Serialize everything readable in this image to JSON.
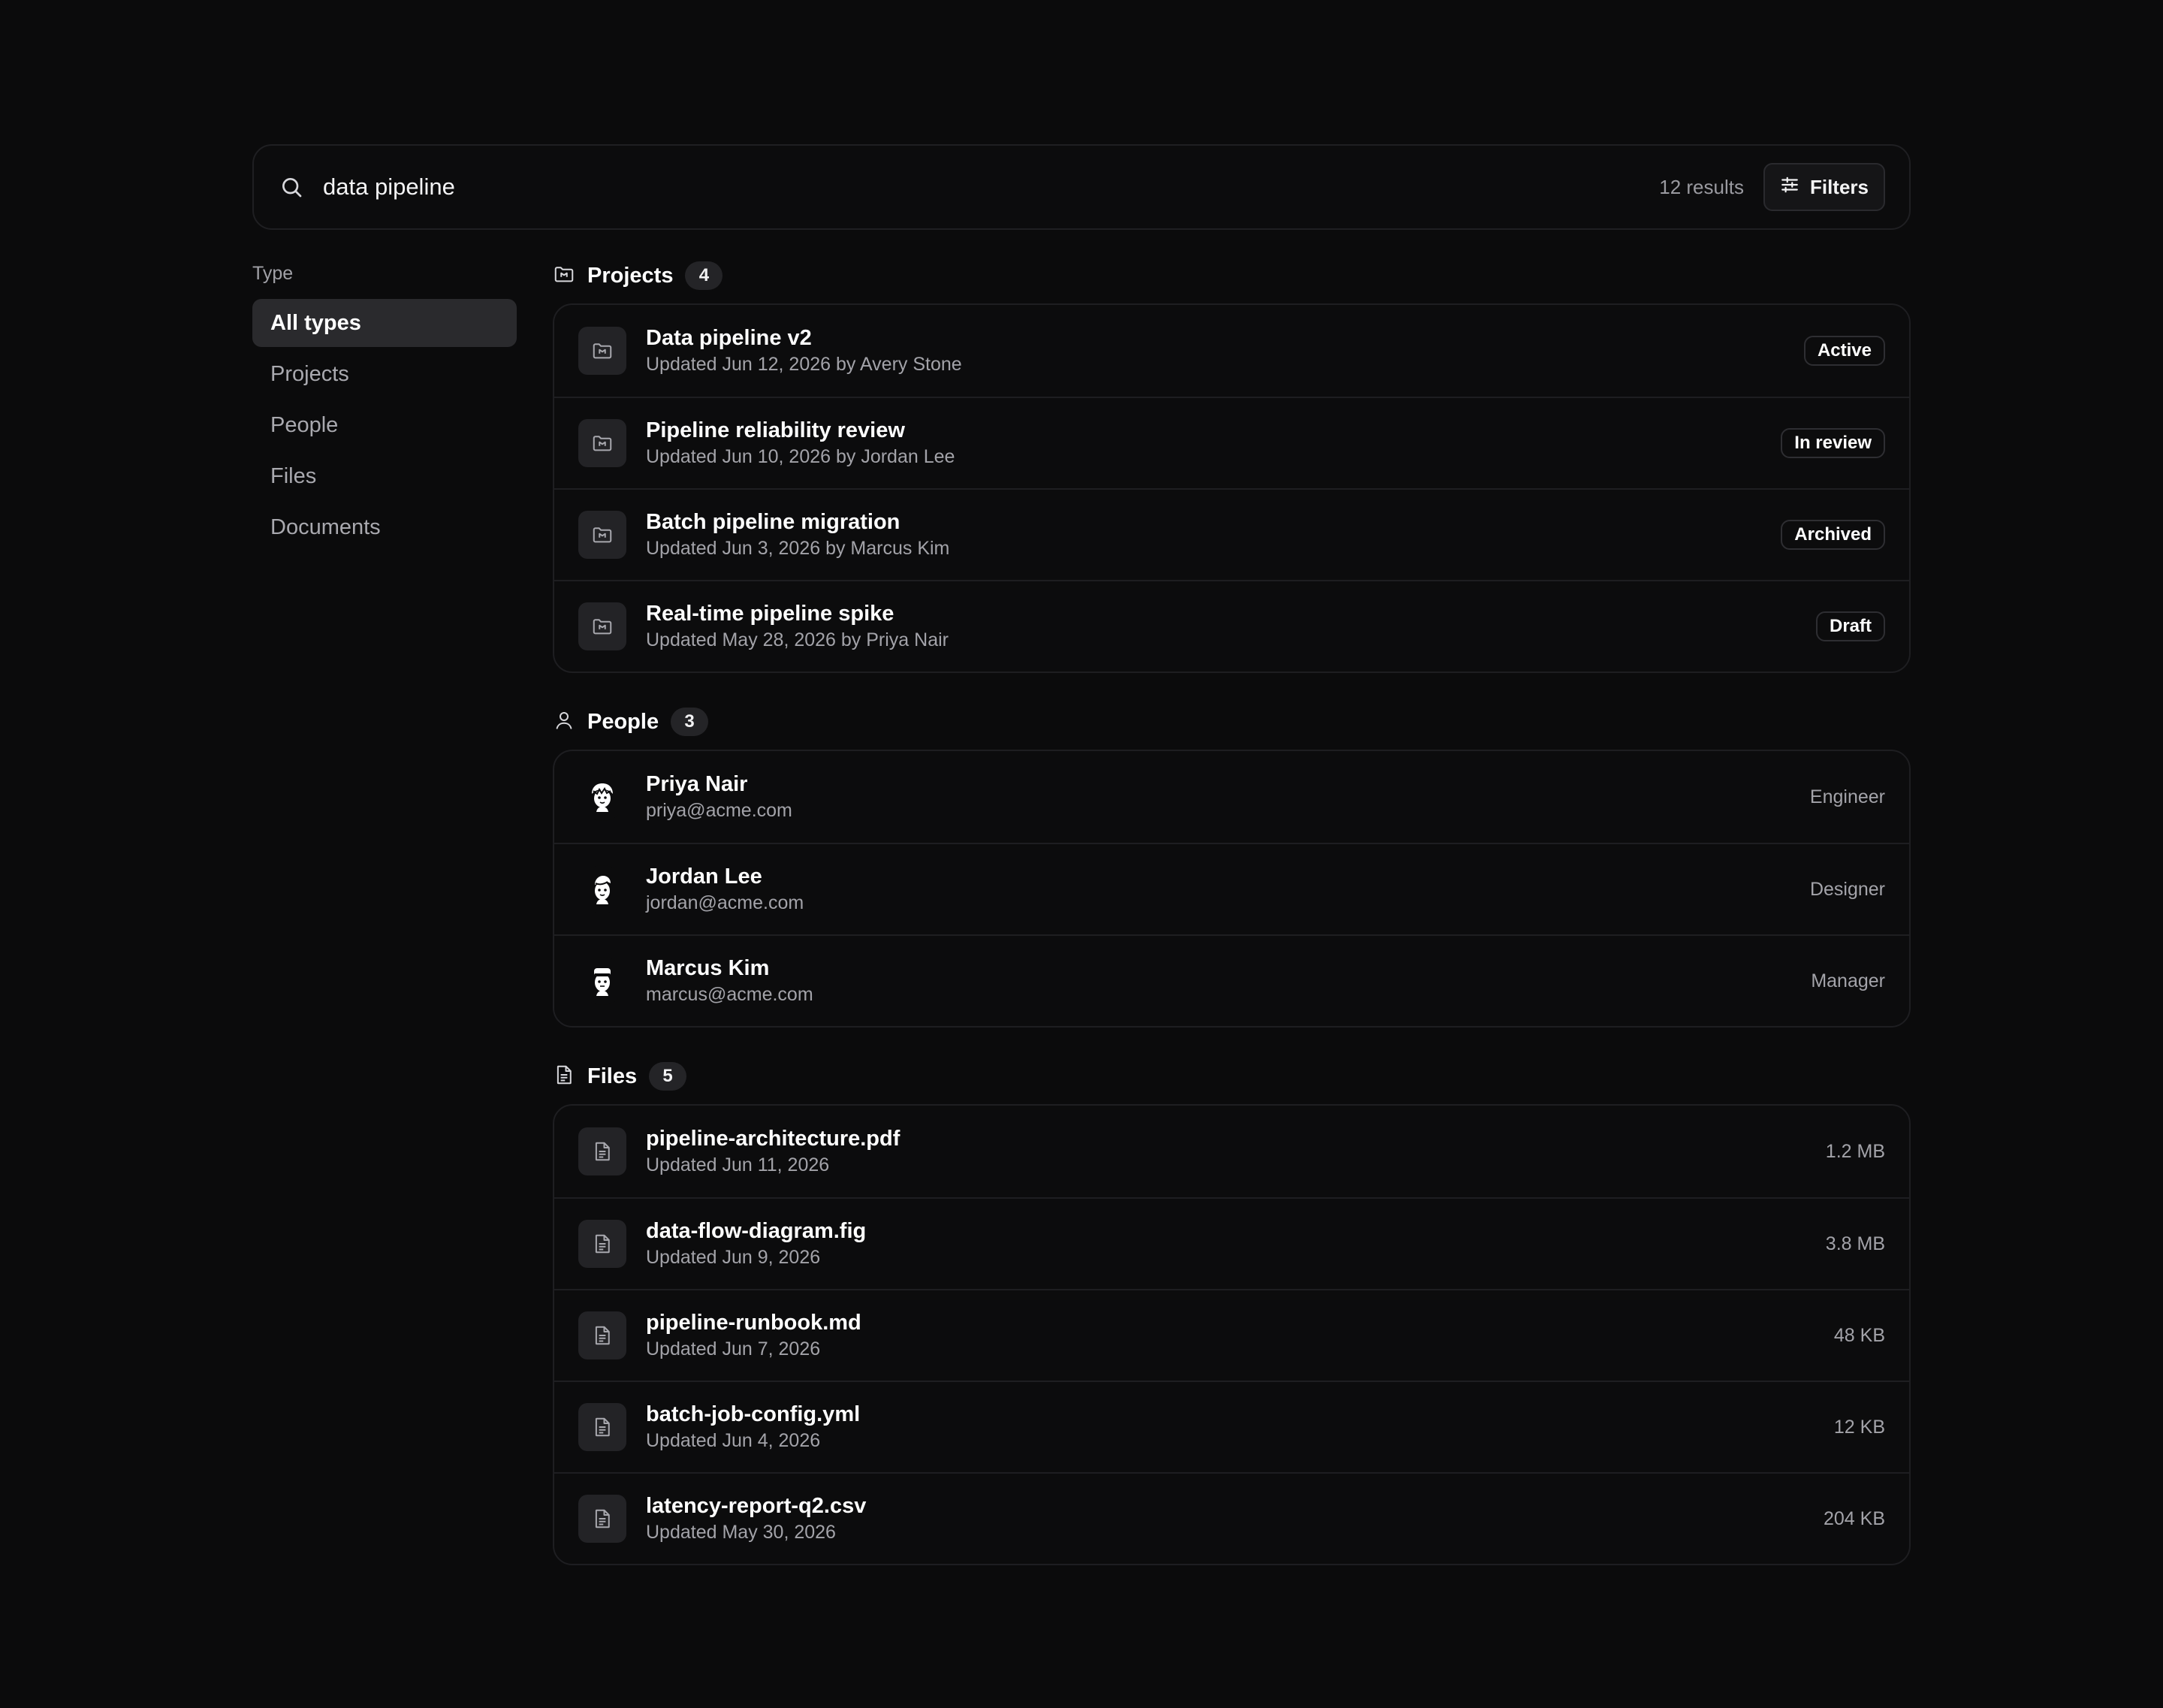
{
  "search": {
    "query": "data pipeline",
    "result_count": "12 results",
    "filters_label": "Filters"
  },
  "sidebar": {
    "title": "Type",
    "items": [
      {
        "label": "All types",
        "active": true
      },
      {
        "label": "Projects"
      },
      {
        "label": "People"
      },
      {
        "label": "Files"
      },
      {
        "label": "Documents"
      }
    ]
  },
  "projects": {
    "title": "Projects",
    "count": "4",
    "items": [
      {
        "name": "Data pipeline v2",
        "meta": "Updated Jun 12, 2026 by Avery Stone",
        "status": "Active"
      },
      {
        "name": "Pipeline reliability review",
        "meta": "Updated Jun 10, 2026 by Jordan Lee",
        "status": "In review"
      },
      {
        "name": "Batch pipeline migration",
        "meta": "Updated Jun 3, 2026 by Marcus Kim",
        "status": "Archived"
      },
      {
        "name": "Real-time pipeline spike",
        "meta": "Updated May 28, 2026 by Priya Nair",
        "status": "Draft"
      }
    ]
  },
  "people": {
    "title": "People",
    "count": "3",
    "items": [
      {
        "name": "Priya Nair",
        "email": "priya@acme.com",
        "role": "Engineer"
      },
      {
        "name": "Jordan Lee",
        "email": "jordan@acme.com",
        "role": "Designer"
      },
      {
        "name": "Marcus Kim",
        "email": "marcus@acme.com",
        "role": "Manager"
      }
    ]
  },
  "files": {
    "title": "Files",
    "count": "5",
    "items": [
      {
        "name": "pipeline-architecture.pdf",
        "meta": "Updated Jun 11, 2026",
        "size": "1.2 MB"
      },
      {
        "name": "data-flow-diagram.fig",
        "meta": "Updated Jun 9, 2026",
        "size": "3.8 MB"
      },
      {
        "name": "pipeline-runbook.md",
        "meta": "Updated Jun 7, 2026",
        "size": "48 KB"
      },
      {
        "name": "batch-job-config.yml",
        "meta": "Updated Jun 4, 2026",
        "size": "12 KB"
      },
      {
        "name": "latency-report-q2.csv",
        "meta": "Updated May 30, 2026",
        "size": "204 KB"
      }
    ]
  }
}
